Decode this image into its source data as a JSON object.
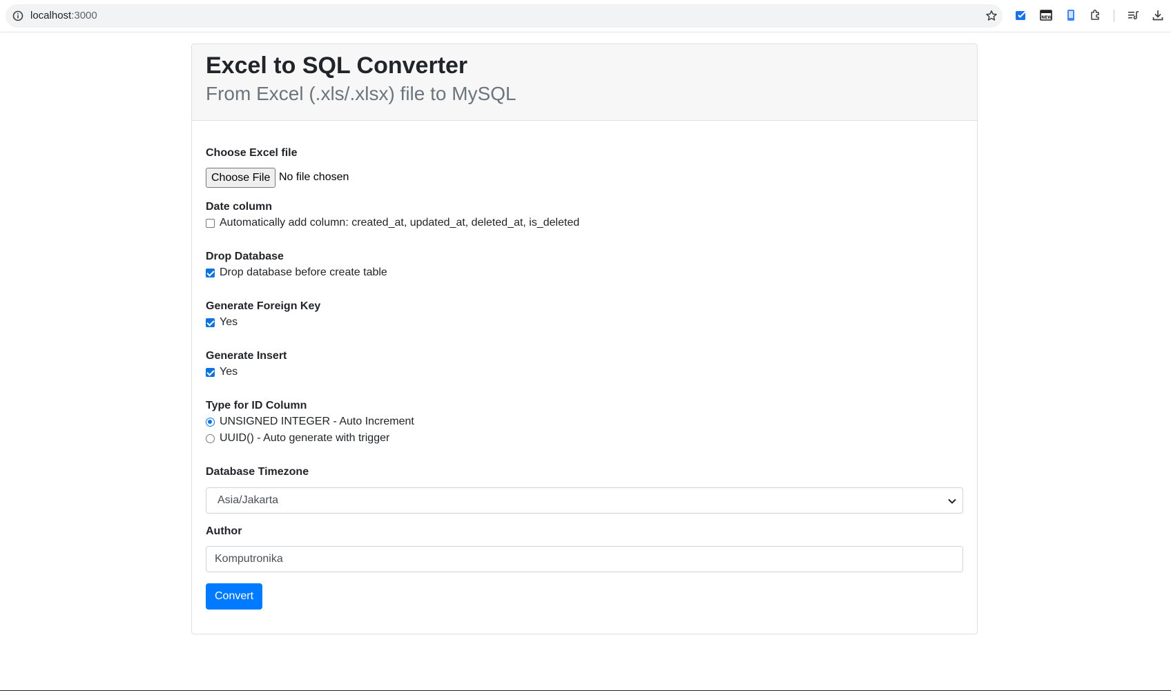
{
  "browser": {
    "url_host": "localhost",
    "url_port": ":3000",
    "icons": [
      "info-icon",
      "bookmark-star-icon",
      "extension-todo-icon",
      "extension-news-icon",
      "extension-phone-icon",
      "extensions-puzzle-icon",
      "reading-list-icon",
      "download-icon"
    ]
  },
  "header": {
    "title": "Excel to SQL Converter",
    "subtitle": "From Excel (.xls/.xlsx) file to MySQL"
  },
  "form": {
    "file": {
      "label": "Choose Excel file",
      "button": "Choose File",
      "status": "No file chosen"
    },
    "date_column": {
      "label": "Date column",
      "option": "Automatically add column: created_at, updated_at, deleted_at, is_deleted",
      "checked": false
    },
    "drop_database": {
      "label": "Drop Database",
      "option": "Drop database before create table",
      "checked": true
    },
    "foreign_key": {
      "label": "Generate Foreign Key",
      "option": "Yes",
      "checked": true
    },
    "insert": {
      "label": "Generate Insert",
      "option": "Yes",
      "checked": true
    },
    "id_type": {
      "label": "Type for ID Column",
      "options": [
        {
          "label": "UNSIGNED INTEGER - Auto Increment",
          "selected": true
        },
        {
          "label": "UUID() - Auto generate with trigger",
          "selected": false
        }
      ]
    },
    "timezone": {
      "label": "Database Timezone",
      "value": "Asia/Jakarta"
    },
    "author": {
      "label": "Author",
      "value": "Komputronika"
    },
    "submit_label": "Convert"
  },
  "colors": {
    "primary": "#007bff",
    "checkbox": "#0b74de",
    "muted": "#6c757d"
  }
}
